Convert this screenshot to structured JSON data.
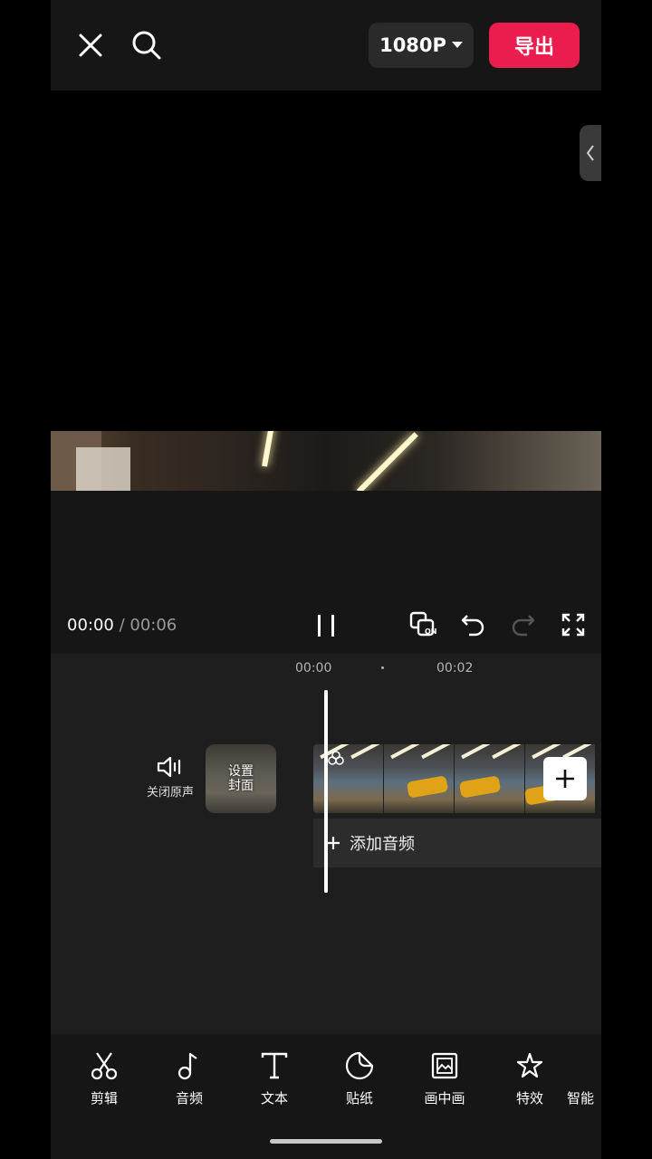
{
  "topbar": {
    "resolution_label": "1080P",
    "export_label": "导出",
    "close_icon": "close-icon",
    "search_icon": "search-icon",
    "brand_color": "#ea1d4e"
  },
  "player": {
    "current_time": "00:00",
    "separator": " / ",
    "total_time": "00:06"
  },
  "timeline": {
    "ruler": [
      "00:00",
      "00:02"
    ],
    "mute_label": "关闭原声",
    "cover_label_line1": "设置",
    "cover_label_line2": "封面",
    "add_audio_label": "添加音频"
  },
  "toolbar": {
    "items": [
      {
        "label": "剪辑",
        "icon": "scissors-icon"
      },
      {
        "label": "音频",
        "icon": "music-note-icon"
      },
      {
        "label": "文本",
        "icon": "text-icon"
      },
      {
        "label": "贴纸",
        "icon": "sticker-icon"
      },
      {
        "label": "画中画",
        "icon": "picture-in-picture-icon"
      },
      {
        "label": "特效",
        "icon": "effects-star-icon"
      },
      {
        "label": "智能",
        "icon": "smart-icon"
      }
    ]
  }
}
